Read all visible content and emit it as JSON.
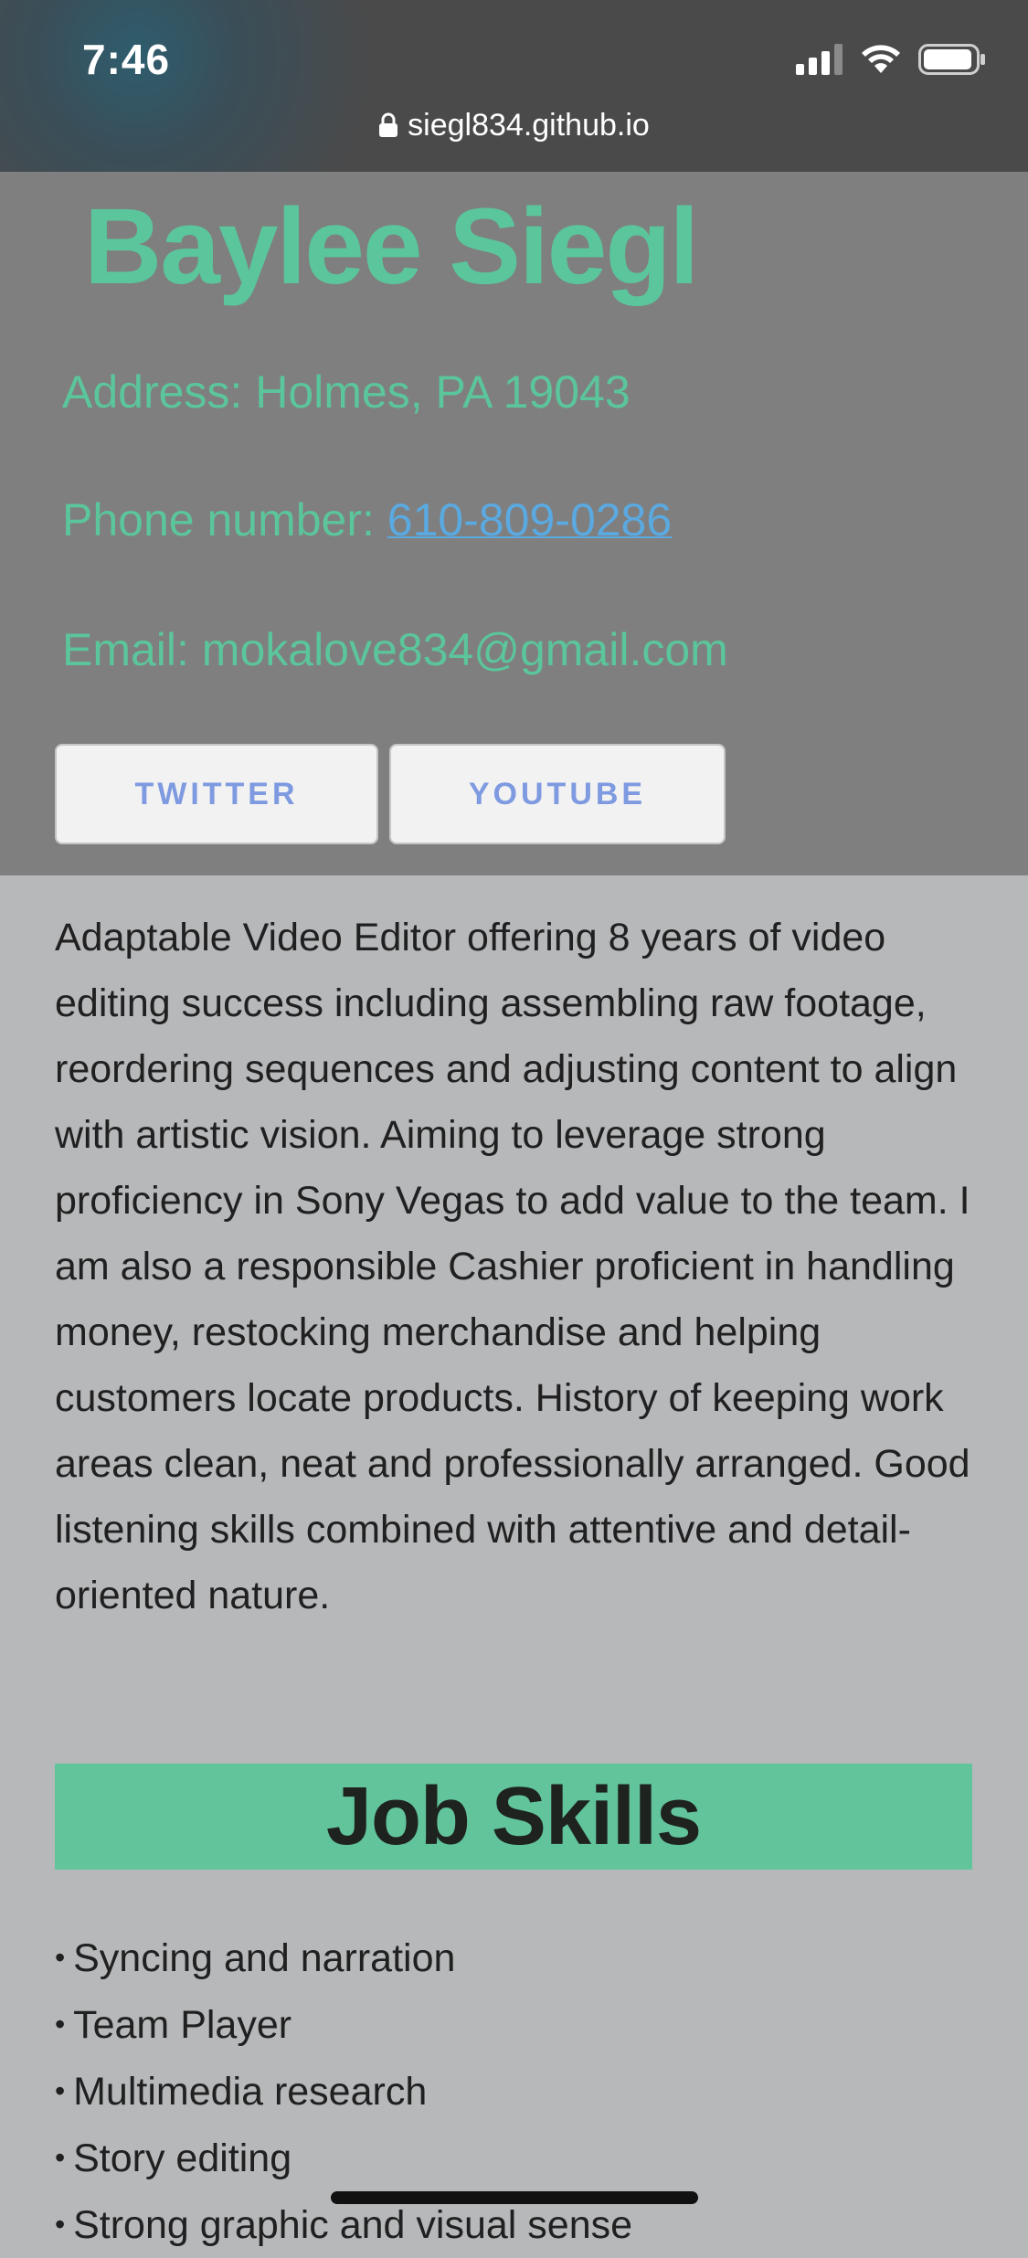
{
  "status_bar": {
    "time": "7:46",
    "icons": [
      "signal-icon",
      "wifi-icon",
      "battery-icon"
    ]
  },
  "browser": {
    "url": "siegl834.github.io",
    "icon": "lock-icon"
  },
  "header": {
    "name": "Baylee Siegl",
    "address": "Address: Holmes, PA 19043",
    "phone_label": "Phone number: ",
    "phone": "610-809-0286",
    "email": "Email: mokalove834@gmail.com"
  },
  "social": {
    "twitter_label": "TWITTER",
    "youtube_label": "YOUTUBE"
  },
  "summary": "Adaptable Video Editor offering 8 years of video editing success including assembling raw footage, reordering sequences and adjusting content to align with artistic vision. Aiming to leverage strong proficiency in Sony Vegas to add value to the team. I am also a responsible Cashier proficient in handling money, restocking merchandise and helping customers locate products. History of keeping work areas clean, neat and professionally arranged. Good listening skills combined with attentive and detail-oriented nature.",
  "skills": {
    "heading": "Job Skills",
    "items": [
      "Syncing and narration",
      "Team Player",
      "Multimedia research",
      "Story editing",
      "Strong graphic and visual sense"
    ]
  },
  "colors": {
    "accent": "#5bc59b",
    "link": "#5aa9e0",
    "button_text": "#7e9ae0",
    "header_bg": "#7f7f7f",
    "page_bg": "#b7b8ba"
  }
}
